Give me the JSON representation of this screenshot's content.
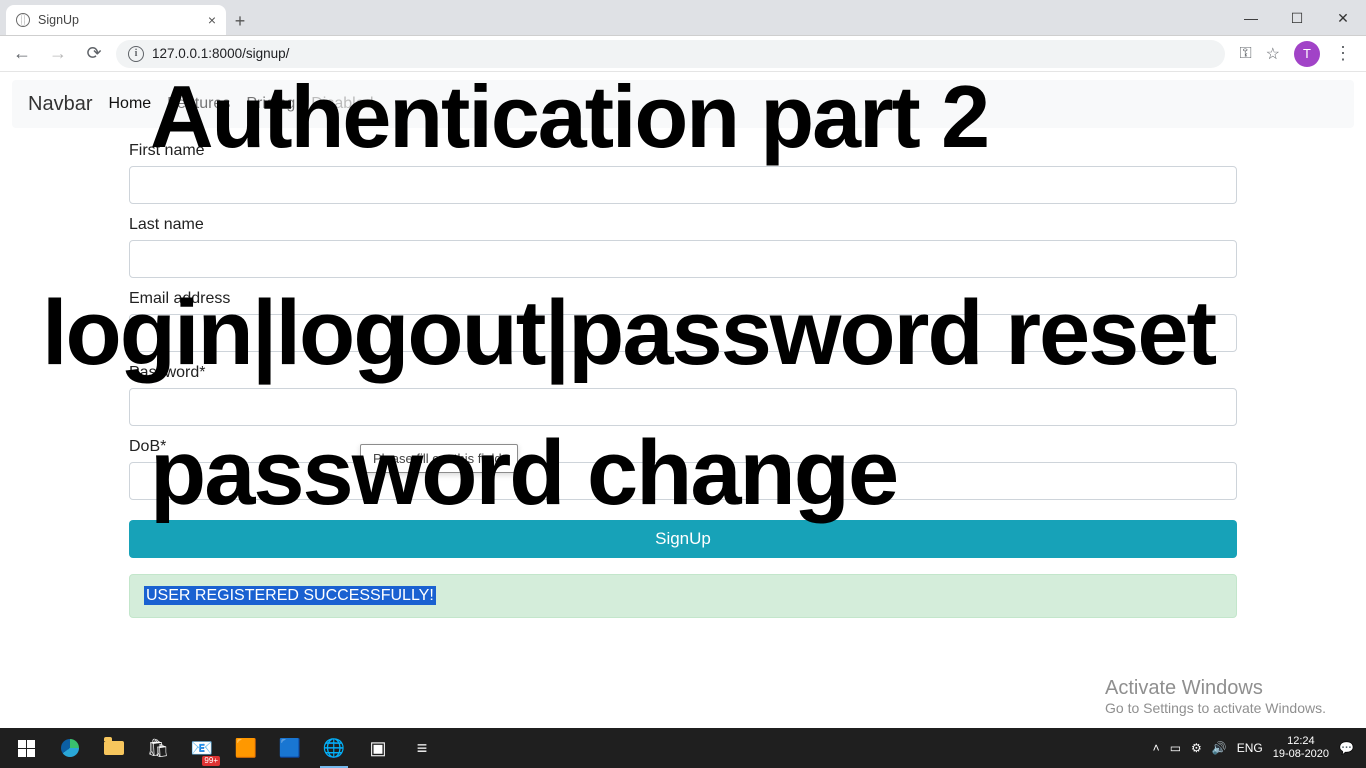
{
  "browser": {
    "tab_title": "SignUp",
    "url": "127.0.0.1:8000/signup/",
    "avatar_letter": "T"
  },
  "navbar": {
    "brand": "Navbar",
    "links": [
      "Home",
      "Features",
      "Pricing",
      "Disabled"
    ]
  },
  "form": {
    "first_name_label": "First name",
    "last_name_label": "Last name",
    "email_label": "Email address",
    "password_label": "Password*",
    "dob_label": "DoB*",
    "submit_label": "SignUp",
    "validation_msg": "Please fill out this field."
  },
  "alert": {
    "text": "USER REGISTERED SUCCESSFULLY!"
  },
  "overlay": {
    "line1": "Authentication part 2",
    "line2": "login|logout|password reset",
    "line3": "password change"
  },
  "watermark": {
    "title": "Activate Windows",
    "sub": "Go to Settings to activate Windows."
  },
  "taskbar": {
    "lang": "ENG",
    "time": "12:24",
    "date": "19-08-2020",
    "mail_badge": "99+"
  }
}
